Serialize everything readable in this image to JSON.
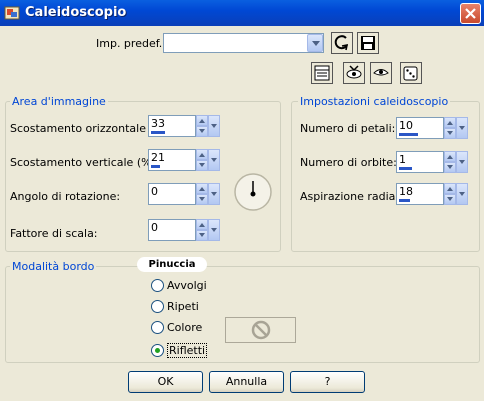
{
  "window": {
    "title": "Caleidoscopio"
  },
  "presets": {
    "label": "Imp. predef.:",
    "value": ""
  },
  "area": {
    "legend": "Area d'immagine",
    "fields": [
      {
        "label": "Scostamento orizzontale (%):",
        "value": "33",
        "fill": 0.33
      },
      {
        "label": "Scostamento verticale (%):",
        "value": "21",
        "fill": 0.21
      },
      {
        "label": "Angolo di rotazione:",
        "value": "0",
        "fill": 0.0
      },
      {
        "label": "Fattore di scala:",
        "value": "0",
        "fill": 0.0
      }
    ]
  },
  "kaleido": {
    "legend": "Impostazioni caleidoscopio",
    "fields": [
      {
        "label": "Numero di petali:",
        "value": "10",
        "fill": 0.45
      },
      {
        "label": "Numero di orbite:",
        "value": "1",
        "fill": 0.3
      },
      {
        "label": "Aspirazione radiale:",
        "value": "18",
        "fill": 0.25
      }
    ]
  },
  "edge": {
    "legend": "Modalità bordo",
    "watermark": "Pinuccia",
    "options": [
      {
        "label": "Avvolgi",
        "selected": false
      },
      {
        "label": "Ripeti",
        "selected": false
      },
      {
        "label": "Colore",
        "selected": false
      },
      {
        "label": "Rifletti",
        "selected": true
      }
    ]
  },
  "buttons": {
    "ok": "OK",
    "cancel": "Annulla",
    "help": "?"
  },
  "colors": {
    "accent": "#0046d5",
    "titlebar": "#0054e3",
    "selected_radio": "#21a121"
  }
}
